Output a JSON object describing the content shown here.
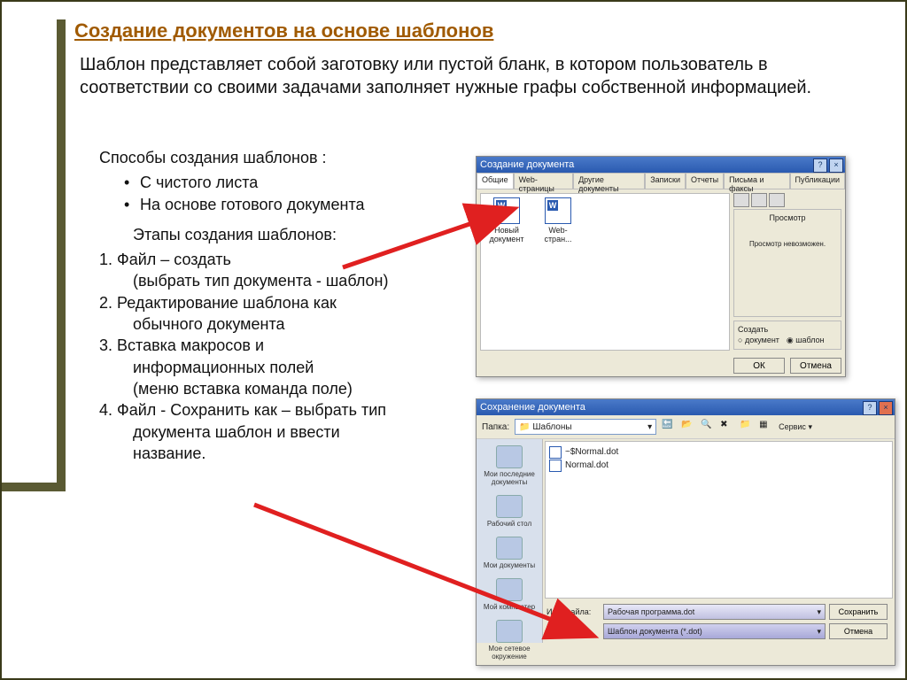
{
  "title": "Создание документов на основе шаблонов",
  "intro": "Шаблон представляет собой заготовку или пустой бланк, в котором пользователь в соответствии со своими задачами заполняет нужные графы собственной информацией.",
  "methods_title": "Способы создания шаблонов :",
  "methods": [
    "С чистого листа",
    "На основе готового документа"
  ],
  "steps_title": "Этапы создания шаблонов:",
  "steps": [
    {
      "n": "1.",
      "t": "Файл – создать",
      "sub": "(выбрать тип документа - шаблон)"
    },
    {
      "n": "2.",
      "t": "Редактирование шаблона как",
      "sub": "обычного документа"
    },
    {
      "n": "3.",
      "t": "Вставка макросов и",
      "sub": "информационных полей",
      "sub2": "(меню вставка команда поле)"
    },
    {
      "n": "4.",
      "t": "Файл - Сохранить как – выбрать тип",
      "sub": "документа шаблон и ввести",
      "sub2": "название."
    }
  ],
  "dlg1": {
    "title": "Создание документа",
    "tabs": [
      "Общие",
      "Web-страницы",
      "Другие документы",
      "Записки",
      "Отчеты",
      "Письма и факсы",
      "Публикации"
    ],
    "items": [
      {
        "label": "Новый документ"
      },
      {
        "label": "Web-стран..."
      }
    ],
    "preview_label": "Просмотр",
    "preview_msg": "Просмотр невозможен.",
    "create_label": "Создать",
    "radio_doc": "документ",
    "radio_tpl": "шаблон",
    "ok": "ОК",
    "cancel": "Отмена"
  },
  "dlg2": {
    "title": "Сохранение документа",
    "folder_label": "Папка:",
    "folder": "Шаблоны",
    "service": "Сервис",
    "places": [
      "Мои последние документы",
      "Рабочий стол",
      "Мои документы",
      "Мой компьютер",
      "Мое сетевое окружение"
    ],
    "files": [
      "~$Normal.dot",
      "Normal.dot"
    ],
    "fname_label": "Имя файла:",
    "fname": "Рабочая программа.dot",
    "ftype_label": "Тип файла:",
    "ftype": "Шаблон документа (*.dot)",
    "save": "Сохранить",
    "cancel": "Отмена"
  }
}
